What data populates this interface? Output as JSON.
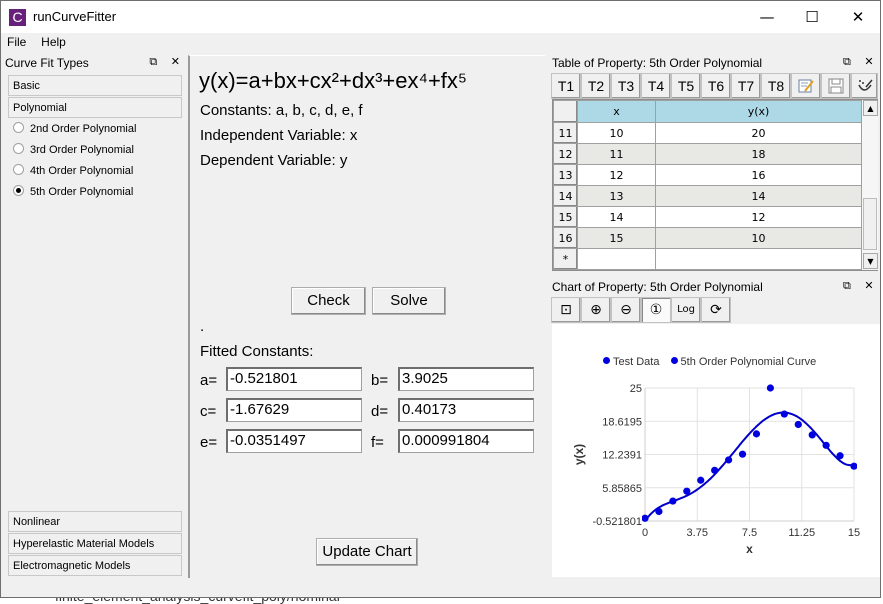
{
  "window": {
    "title": "runCurveFitter",
    "app_icon_letter": "C",
    "minimize": "—",
    "maximize": "☐",
    "close": "✕"
  },
  "menu": [
    "File",
    "Help"
  ],
  "left_dock": {
    "title": "Curve Fit Types",
    "float_icon": "⧉",
    "close_icon": "✕",
    "categories_top": [
      "Basic",
      "Polynomial"
    ],
    "options": [
      {
        "label": "2nd Order Polynomial",
        "selected": false
      },
      {
        "label": "3rd Order Polynomial",
        "selected": false
      },
      {
        "label": "4th Order Polynomial",
        "selected": false
      },
      {
        "label": "5th Order Polynomial",
        "selected": true
      }
    ],
    "categories_bottom": [
      "Nonlinear",
      "Hyperelastic Material Models",
      "Electromagnetic Models"
    ]
  },
  "center": {
    "formula": "y(x)=a+bx+cx²+dx³+ex⁴+fx⁵",
    "constants": "Constants: a, b, c, d, e, f",
    "independent": "Independent Variable: x",
    "dependent": "Dependent Variable: y",
    "check_label": "Check",
    "solve_label": "Solve",
    "status": ".",
    "fitted_title": "Fitted Constants:",
    "fitted": [
      {
        "label": "a=",
        "value": "-0.521801"
      },
      {
        "label": "b=",
        "value": "3.9025"
      },
      {
        "label": "c=",
        "value": "-1.67629"
      },
      {
        "label": "d=",
        "value": "0.40173"
      },
      {
        "label": "e=",
        "value": "-0.0351497"
      },
      {
        "label": "f=",
        "value": "0.000991804"
      }
    ],
    "update_chart_label": "Update Chart"
  },
  "table_dock": {
    "title": "Table of Property: 5th Order Polynomial",
    "float_icon": "⧉",
    "close_icon": "✕",
    "tabs": [
      "T1",
      "T2",
      "T3",
      "T4",
      "T5",
      "T6",
      "T7",
      "T8"
    ],
    "tool_icons": [
      "edit-icon",
      "save-icon",
      "clear-icon"
    ],
    "columns": [
      "x",
      "y(x)"
    ],
    "rows": [
      {
        "index": "11",
        "x": "10",
        "y": "20"
      },
      {
        "index": "12",
        "x": "11",
        "y": "18"
      },
      {
        "index": "13",
        "x": "12",
        "y": "16"
      },
      {
        "index": "14",
        "x": "13",
        "y": "14"
      },
      {
        "index": "15",
        "x": "14",
        "y": "12"
      },
      {
        "index": "16",
        "x": "15",
        "y": "10"
      },
      {
        "index": "*",
        "x": "",
        "y": ""
      }
    ]
  },
  "chart_dock": {
    "title": "Chart of Property: 5th Order Polynomial",
    "float_icon": "⧉",
    "close_icon": "✕",
    "tools": [
      {
        "name": "fit-view",
        "glyph": "⊡"
      },
      {
        "name": "zoom-in",
        "glyph": "⊕"
      },
      {
        "name": "zoom-out",
        "glyph": "⊖"
      },
      {
        "name": "linear",
        "glyph": "①"
      },
      {
        "name": "log",
        "glyph": "Log"
      },
      {
        "name": "refresh",
        "glyph": "⟳"
      }
    ]
  },
  "chart_data": {
    "type": "scatter",
    "title": "",
    "xlabel": "x",
    "ylabel": "y(x)",
    "xlim": [
      0,
      15
    ],
    "ylim": [
      -0.521801,
      25
    ],
    "x_ticks": [
      "0",
      "3.75",
      "7.5",
      "11.25",
      "15"
    ],
    "y_ticks": [
      "-0.521801",
      "5.85865",
      "12.2391",
      "18.6195",
      "25"
    ],
    "grid": true,
    "legend_position": "top",
    "series": [
      {
        "name": "Test Data",
        "kind": "scatter",
        "color": "#0000e0",
        "x": [
          0,
          1,
          2,
          3,
          4,
          5,
          6,
          7,
          8,
          9,
          10,
          11,
          12,
          13,
          14,
          15
        ],
        "y": [
          0,
          1.3,
          3.3,
          5.2,
          7.3,
          9.2,
          11.2,
          12.3,
          16.2,
          25,
          20,
          18,
          16,
          14,
          12,
          10
        ]
      },
      {
        "name": "5th Order Polynomial Curve",
        "kind": "line",
        "color": "#0000c8",
        "coefficients": [
          -0.521801,
          3.9025,
          -1.67629,
          0.40173,
          -0.0351497,
          0.000991804
        ]
      }
    ]
  },
  "background_text": "finite_element_analysis_curvefit_poly/nominal"
}
